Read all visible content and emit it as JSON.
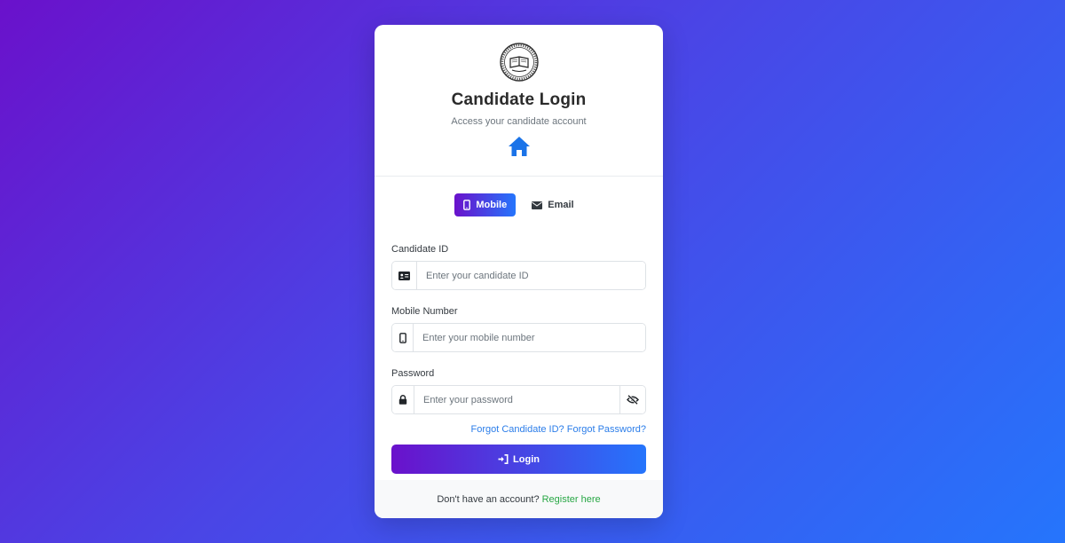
{
  "header": {
    "title": "Candidate Login",
    "subtitle": "Access your candidate account"
  },
  "toggle": {
    "mobile_label": "Mobile",
    "email_label": "Email",
    "active": "mobile"
  },
  "form": {
    "candidate_id": {
      "label": "Candidate ID",
      "placeholder": "Enter your candidate ID",
      "value": ""
    },
    "mobile": {
      "label": "Mobile Number",
      "placeholder": "Enter your mobile number",
      "value": ""
    },
    "password": {
      "label": "Password",
      "placeholder": "Enter your password",
      "value": ""
    },
    "forgot_id": "Forgot Candidate ID?",
    "forgot_password": "Forgot Password?",
    "login_label": "Login"
  },
  "footer": {
    "prompt": "Don't have an account?",
    "register_link": "Register here"
  },
  "colors": {
    "gradient_start": "#6a11cb",
    "gradient_end": "#2575fc",
    "link_blue": "#2b7de9",
    "register_green": "#28a745",
    "home_icon": "#1a73e8"
  },
  "icons": {
    "logo": "institution-seal-icon",
    "home": "home-icon",
    "mobile": "mobile-phone-icon",
    "email": "envelope-icon",
    "candidate_id": "id-card-icon",
    "lock": "lock-icon",
    "visibility": "eye-slash-icon",
    "login": "sign-in-icon"
  }
}
